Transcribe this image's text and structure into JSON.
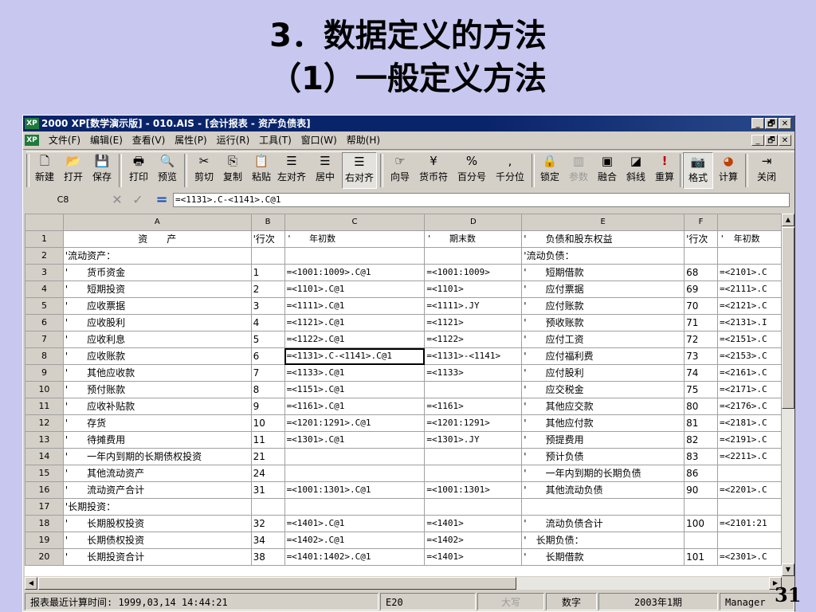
{
  "slide": {
    "title_line1": "3．数据定义的方法",
    "title_line2": "（1）一般定义方法",
    "page_number": "31"
  },
  "window": {
    "logo": "XP",
    "title": "2000 XP[数学演示版] - 010.AIS - [会计报表 - 资产负债表]",
    "controls": [
      "_",
      "🗗",
      "✕"
    ]
  },
  "menubar": {
    "logo": "XP",
    "items": [
      "文件(F)",
      "编辑(E)",
      "查看(V)",
      "属性(P)",
      "运行(R)",
      "工具(T)",
      "窗口(W)",
      "帮助(H)"
    ],
    "controls": [
      "_",
      "🗗",
      "✕"
    ]
  },
  "toolbar": {
    "buttons": [
      {
        "icon": "new-file-icon",
        "glyph": "🗋",
        "label": "新建"
      },
      {
        "icon": "open-folder-icon",
        "glyph": "📂",
        "label": "打开"
      },
      {
        "icon": "save-disk-icon",
        "glyph": "💾",
        "label": "保存"
      },
      {
        "icon": "printer-icon",
        "glyph": "🖶",
        "label": "打印"
      },
      {
        "icon": "print-preview-icon",
        "glyph": "🔍",
        "label": "预览"
      },
      {
        "icon": "scissors-icon",
        "glyph": "✂",
        "label": "剪切"
      },
      {
        "icon": "copy-icon",
        "glyph": "⎘",
        "label": "复制"
      },
      {
        "icon": "paste-icon",
        "glyph": "📋",
        "label": "粘贴"
      },
      {
        "icon": "align-left-icon",
        "glyph": "☰",
        "label": "左对齐"
      },
      {
        "icon": "align-center-icon",
        "glyph": "☰",
        "label": "居中"
      },
      {
        "icon": "align-right-icon",
        "glyph": "☰",
        "label": "右对齐"
      },
      {
        "icon": "wizard-hand-icon",
        "glyph": "☞",
        "label": "向导"
      },
      {
        "icon": "currency-icon",
        "glyph": "¥",
        "label": "货币符"
      },
      {
        "icon": "percent-icon",
        "glyph": "%",
        "label": "百分号"
      },
      {
        "icon": "comma-icon",
        "glyph": ",",
        "label": "千分位"
      },
      {
        "icon": "lock-icon",
        "glyph": "🔒",
        "label": "锁定"
      },
      {
        "icon": "parameter-icon",
        "glyph": "▥",
        "label": "参数"
      },
      {
        "icon": "merge-cells-icon",
        "glyph": "▣",
        "label": "融合"
      },
      {
        "icon": "diagonal-line-icon",
        "glyph": "◪",
        "label": "斜线"
      },
      {
        "icon": "recalculate-icon",
        "glyph": "!",
        "label": "重算"
      },
      {
        "icon": "format-camera-icon",
        "glyph": "📷",
        "label": "格式"
      },
      {
        "icon": "calculate-icon",
        "glyph": "◕",
        "label": "计算"
      },
      {
        "icon": "exit-door-icon",
        "glyph": "⇥",
        "label": "关闭"
      }
    ]
  },
  "formula_bar": {
    "cell_ref": "C8",
    "cancel_glyph": "✕",
    "confirm_glyph": "✓",
    "equals_glyph": "=",
    "value": "=<1131>.C-<1141>.C@1"
  },
  "sheet": {
    "columns": [
      "A",
      "B",
      "C",
      "D",
      "E",
      "F",
      ""
    ],
    "rows": [
      [
        "1",
        "资　　产",
        "'行次",
        "'　　年初数",
        "'　　期末数",
        "'　　负债和股东权益",
        "'行次",
        "'　年初数"
      ],
      [
        "2",
        "'流动资产：",
        "",
        "",
        "",
        "'流动负债：",
        "",
        ""
      ],
      [
        "3",
        "'　　货币资金",
        "1",
        "=<1001:1009>.C@1",
        "=<1001:1009>",
        "'　　短期借款",
        "68",
        "=<2101>.C"
      ],
      [
        "4",
        "'　　短期投资",
        "2",
        "=<1101>.C@1",
        "=<1101>",
        "'　　应付票据",
        "69",
        "=<2111>.C"
      ],
      [
        "5",
        "'　　应收票据",
        "3",
        "=<1111>.C@1",
        "=<1111>.JY",
        "'　　应付账款",
        "70",
        "=<2121>.C"
      ],
      [
        "6",
        "'　　应收股利",
        "4",
        "=<1121>.C@1",
        "=<1121>",
        "'　　预收账款",
        "71",
        "=<2131>.I"
      ],
      [
        "7",
        "'　　应收利息",
        "5",
        "=<1122>.C@1",
        "=<1122>",
        "'　　应付工资",
        "72",
        "=<2151>.C"
      ],
      [
        "8",
        "'　　应收账款",
        "6",
        "=<1131>.C-<1141>.C@1",
        "=<1131>-<1141>",
        "'　　应付福利费",
        "73",
        "=<2153>.C"
      ],
      [
        "9",
        "'　　其他应收款",
        "7",
        "=<1133>.C@1",
        "=<1133>",
        "'　　应付股利",
        "74",
        "=<2161>.C"
      ],
      [
        "10",
        "'　　预付账款",
        "8",
        "=<1151>.C@1",
        "",
        "'　　应交税金",
        "75",
        "=<2171>.C"
      ],
      [
        "11",
        "'　　应收补贴款",
        "9",
        "=<1161>.C@1",
        "=<1161>",
        "'　　其他应交款",
        "80",
        "=<2176>.C"
      ],
      [
        "12",
        "'　　存货",
        "10",
        "=<1201:1291>.C@1",
        "=<1201:1291>",
        "'　　其他应付款",
        "81",
        "=<2181>.C"
      ],
      [
        "13",
        "'　　待摊费用",
        "11",
        "=<1301>.C@1",
        "=<1301>.JY",
        "'　　预提费用",
        "82",
        "=<2191>.C"
      ],
      [
        "14",
        "'　　一年内到期的长期债权投资",
        "21",
        "",
        "",
        "'　　预计负债",
        "83",
        "=<2211>.C"
      ],
      [
        "15",
        "'　　其他流动资产",
        "24",
        "",
        "",
        "'　　一年内到期的长期负债",
        "86",
        ""
      ],
      [
        "16",
        "'　　流动资产合计",
        "31",
        "=<1001:1301>.C@1",
        "=<1001:1301>",
        "'　　其他流动负债",
        "90",
        "=<2201>.C"
      ],
      [
        "17",
        "'长期投资：",
        "",
        "",
        "",
        "",
        "",
        ""
      ],
      [
        "18",
        "'　　长期股权投资",
        "32",
        "=<1401>.C@1",
        "=<1401>",
        "'　　流动负债合计",
        "100",
        "=<2101:21"
      ],
      [
        "19",
        "'　　长期债权投资",
        "34",
        "=<1402>.C@1",
        "=<1402>",
        "'　长期负债：",
        "",
        ""
      ],
      [
        "20",
        "'　　长期投资合计",
        "38",
        "=<1401:1402>.C@1",
        "=<1401>",
        "'　　长期借款",
        "101",
        "=<2301>.C"
      ]
    ]
  },
  "statusbar": {
    "last_calc": "报表最近计算时间: 1999,03,14 14:44:21",
    "cell": "E20",
    "caps": "大写",
    "num": "数字",
    "period": "2003年1期",
    "user": "Manager"
  }
}
